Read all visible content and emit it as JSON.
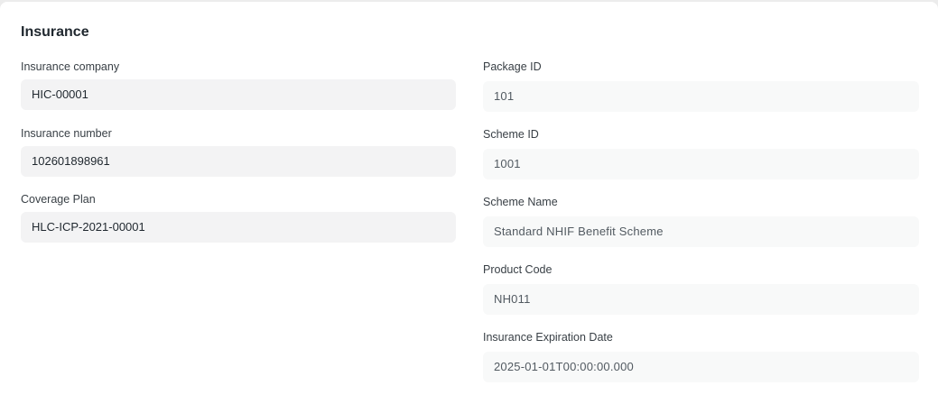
{
  "section": {
    "title": "Insurance"
  },
  "left_fields": [
    {
      "label": "Insurance company",
      "value": "HIC-00001"
    },
    {
      "label": "Insurance number",
      "value": "102601898961"
    },
    {
      "label": "Coverage Plan",
      "value": "HLC-ICP-2021-00001"
    }
  ],
  "right_fields": [
    {
      "label": "Package ID",
      "value": "101"
    },
    {
      "label": "Scheme ID",
      "value": "1001"
    },
    {
      "label": "Scheme Name",
      "value": "Standard NHIF Benefit Scheme"
    },
    {
      "label": "Product Code",
      "value": "NH011"
    },
    {
      "label": "Insurance Expiration Date",
      "value": "2025-01-01T00:00:00.000"
    }
  ]
}
